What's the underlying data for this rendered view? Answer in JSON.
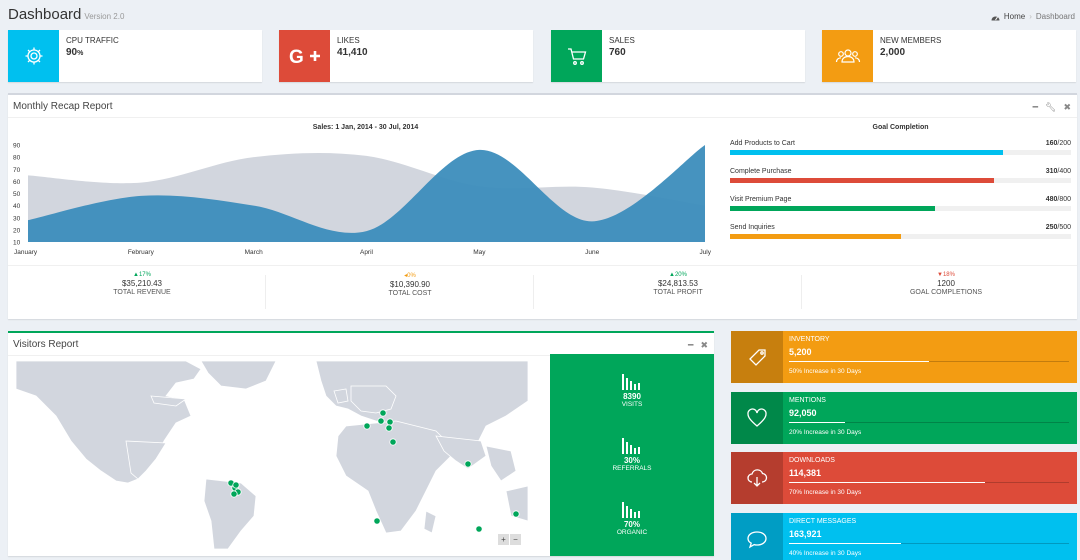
{
  "header": {
    "title": "Dashboard",
    "version": "Version 2.0"
  },
  "breadcrumb": {
    "home": "Home",
    "current": "Dashboard"
  },
  "info_boxes": [
    {
      "label": "CPU TRAFFIC",
      "value": "90",
      "unit": "%",
      "color": "#00c0ef",
      "icon": "gear-icon"
    },
    {
      "label": "LIKES",
      "value": "41,410",
      "color": "#dd4b39",
      "icon": "google-plus-icon"
    },
    {
      "label": "SALES",
      "value": "760",
      "color": "#00a65a",
      "icon": "shopping-cart-icon"
    },
    {
      "label": "NEW MEMBERS",
      "value": "2,000",
      "color": "#f39c12",
      "icon": "users-icon"
    }
  ],
  "monthly": {
    "title": "Monthly Recap Report",
    "goal_title": "Goal Completion",
    "goals": [
      {
        "label": "Add Products to Cart",
        "value": "160",
        "total": "/200",
        "fraction": 0.8,
        "color": "#00c0ef"
      },
      {
        "label": "Complete Purchase",
        "value": "310",
        "total": "/400",
        "fraction": 0.775,
        "color": "#dd4b39"
      },
      {
        "label": "Visit Premium Page",
        "value": "480",
        "total": "/800",
        "fraction": 0.6,
        "color": "#00a65a"
      },
      {
        "label": "Send Inquiries",
        "value": "250",
        "total": "/500",
        "fraction": 0.5,
        "color": "#f39c12"
      }
    ],
    "descriptions": [
      {
        "pct": "▲17%",
        "amount": "$35,210.43",
        "text": "TOTAL REVENUE",
        "color": "#00a65a"
      },
      {
        "pct": "◂0%",
        "amount": "$10,390.90",
        "text": "TOTAL COST",
        "color": "#f39c12"
      },
      {
        "pct": "▲20%",
        "amount": "$24,813.53",
        "text": "TOTAL PROFIT",
        "color": "#00a65a"
      },
      {
        "pct": "▼18%",
        "amount": "1200",
        "text": "GOAL COMPLETIONS",
        "color": "#dd4b39"
      }
    ]
  },
  "chart_data": {
    "type": "area",
    "title": "Sales: 1 Jan, 2014 - 30 Jul, 2014",
    "categories": [
      "January",
      "February",
      "March",
      "April",
      "May",
      "June",
      "July"
    ],
    "ylim": [
      10,
      90
    ],
    "yticks": [
      10,
      20,
      30,
      40,
      50,
      60,
      70,
      80,
      90
    ],
    "series": [
      {
        "values": [
          65,
          59,
          80,
          81,
          56,
          55,
          40
        ],
        "color": "#d2d6de"
      },
      {
        "values": [
          28,
          48,
          40,
          19,
          86,
          27,
          90
        ],
        "color": "#3c8dbc"
      }
    ],
    "grid": false
  },
  "visitors": {
    "title": "Visitors Report",
    "stats": [
      {
        "value": "8390",
        "label": "VISITS"
      },
      {
        "value": "30%",
        "label": "REFERRALS"
      },
      {
        "value": "70%",
        "label": "ORGANIC"
      }
    ],
    "zoom_in": "+",
    "zoom_out": "−"
  },
  "stat_boxes": [
    {
      "label": "INVENTORY",
      "value": "5,200",
      "desc": "50% Increase in 30 Days",
      "progress": 0.5,
      "color": "#f39c12",
      "icon": "tag-icon"
    },
    {
      "label": "MENTIONS",
      "value": "92,050",
      "desc": "20% Increase in 30 Days",
      "progress": 0.2,
      "color": "#00a65a",
      "icon": "heart-icon"
    },
    {
      "label": "DOWNLOADS",
      "value": "114,381",
      "desc": "70% Increase in 30 Days",
      "progress": 0.7,
      "color": "#dd4b39",
      "icon": "cloud-download-icon"
    },
    {
      "label": "DIRECT MESSAGES",
      "value": "163,921",
      "desc": "40% Increase in 30 Days",
      "progress": 0.4,
      "color": "#00c0ef",
      "icon": "chat-bubble-icon"
    }
  ]
}
